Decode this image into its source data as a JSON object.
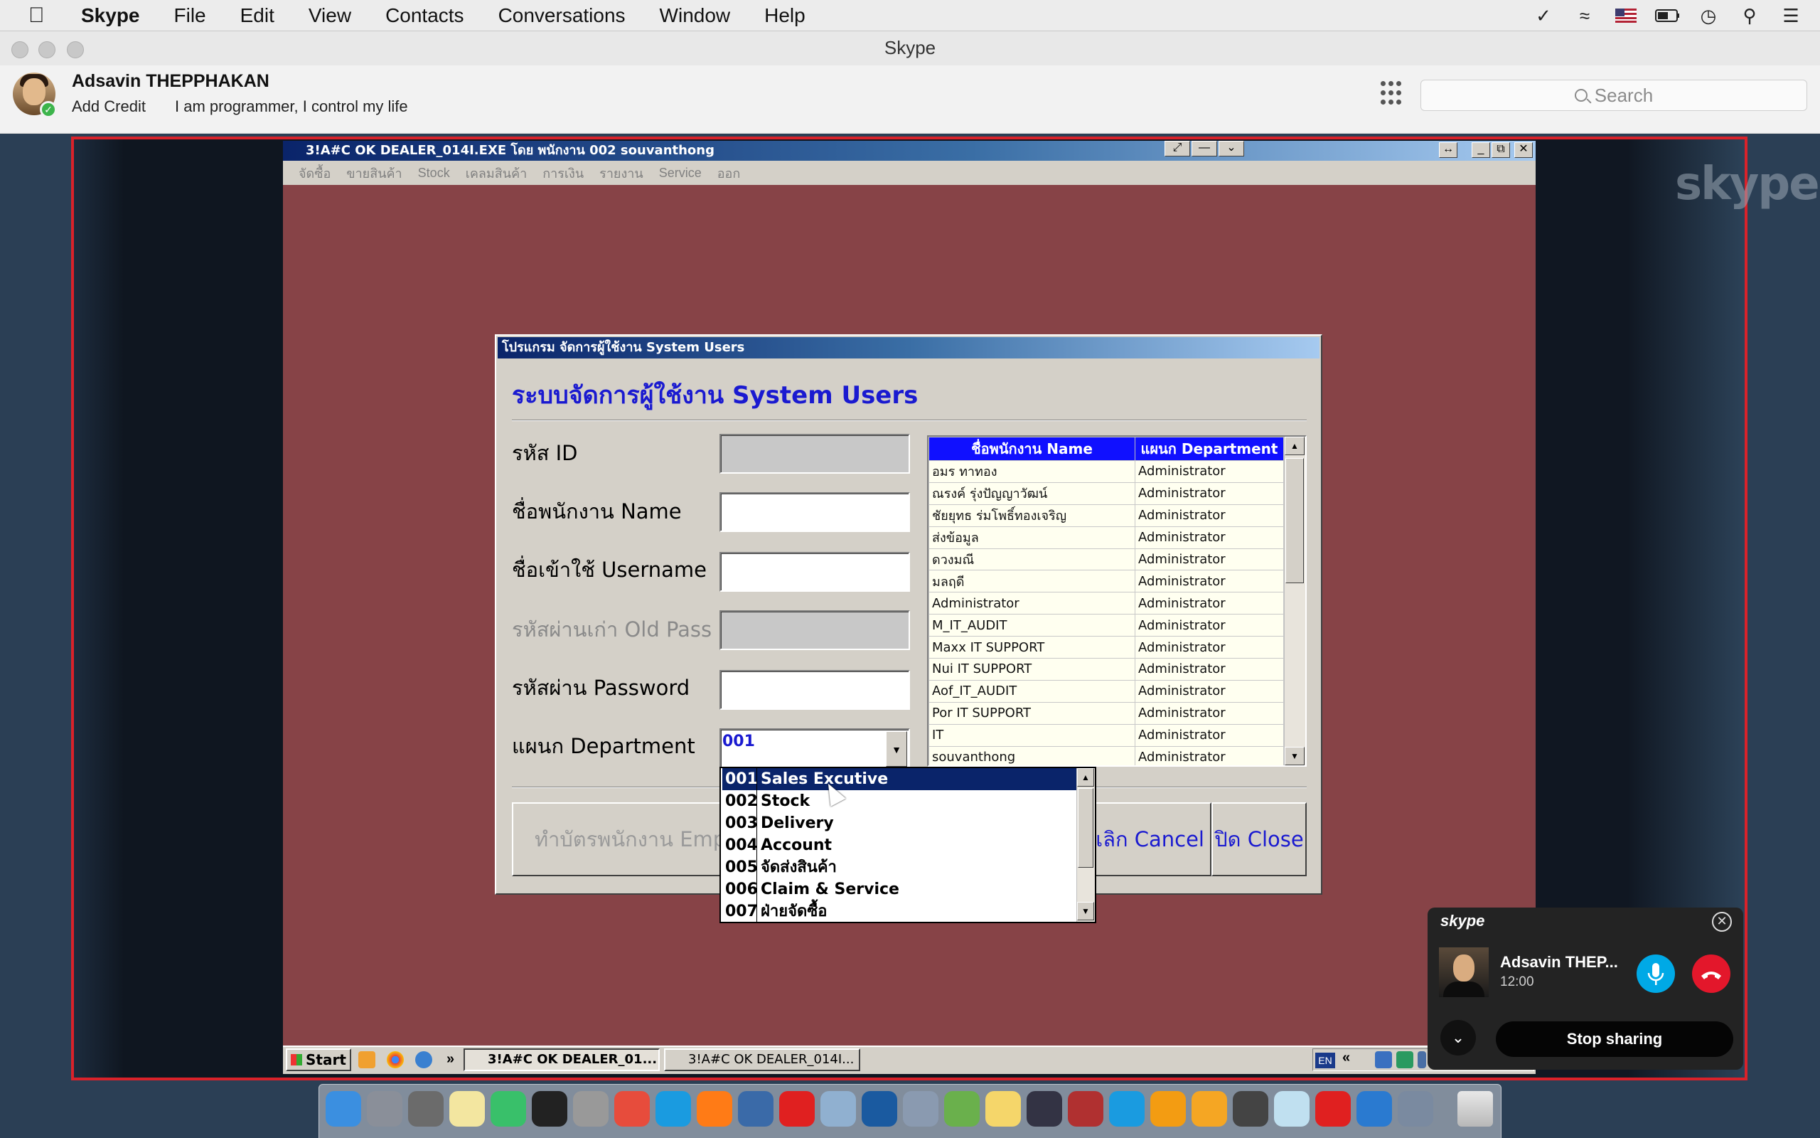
{
  "menubar": {
    "app": "Skype",
    "items": [
      "File",
      "Edit",
      "View",
      "Contacts",
      "Conversations",
      "Window",
      "Help"
    ]
  },
  "window": {
    "title": "Skype"
  },
  "profile": {
    "name": "Adsavin THEPPHAKAN",
    "add_credit": "Add Credit",
    "mood": "I am programmer, I control my life"
  },
  "search": {
    "placeholder": "Search"
  },
  "remote": {
    "title": "3!A#C OK DEALER_014I.EXE โดย พนักงาน 002 souvanthong",
    "menu": [
      "จัดซื้อ",
      "ขายสินค้า",
      "Stock",
      "เคลมสินค้า",
      "การเงิน",
      "รายงาน",
      "Service",
      "ออก"
    ],
    "dialog": {
      "title": "โปรแกรม จัดการผู้ใช้งาน System Users",
      "heading": "ระบบจัดการผู้ใช้งาน System Users",
      "labels": {
        "id": "รหัส ID",
        "name": "ชื่อพนักงาน Name",
        "username": "ชื่อเข้าใช้ Username",
        "old_pass": "รหัสผ่านเก่า Old Pass",
        "password": "รหัสผ่าน Password",
        "department": "แผนก Department"
      },
      "department_value": "001",
      "grid": {
        "headers": [
          "ชื่อพนักงาน Name",
          "แผนก Department"
        ],
        "rows": [
          [
            "อมร ทาทอง",
            "Administrator"
          ],
          [
            "ณรงค์ รุ่งปัญญาวัฒน์",
            "Administrator"
          ],
          [
            "ชัยยุทธ ร่มโพธิ์ทองเจริญ",
            "Administrator"
          ],
          [
            "ส่งข้อมูล",
            "Administrator"
          ],
          [
            "ดวงมณี",
            "Administrator"
          ],
          [
            "มลฤดี",
            "Administrator"
          ],
          [
            "Administrator",
            "Administrator"
          ],
          [
            "M_IT_AUDIT",
            "Administrator"
          ],
          [
            "Maxx IT SUPPORT",
            "Administrator"
          ],
          [
            "Nui IT SUPPORT",
            "Administrator"
          ],
          [
            "Aof_IT_AUDIT",
            "Administrator"
          ],
          [
            "Por IT SUPPORT",
            "Administrator"
          ],
          [
            "IT",
            "Administrator"
          ],
          [
            "souvanthong",
            "Administrator"
          ]
        ]
      },
      "dropdown": [
        {
          "code": "001",
          "name": "Sales Excutive"
        },
        {
          "code": "002",
          "name": "Stock"
        },
        {
          "code": "003",
          "name": "Delivery"
        },
        {
          "code": "004",
          "name": "Account"
        },
        {
          "code": "005",
          "name": "จัดส่งสินค้า"
        },
        {
          "code": "006",
          "name": "Claim & Service"
        },
        {
          "code": "007",
          "name": "ฝ่ายจัดซื้อ"
        }
      ],
      "buttons": {
        "card": "ทำบัตรพนักงาน Emp",
        "cancel": "ยกเลิก Cancel",
        "close": "ปิด Close"
      }
    },
    "taskbar": {
      "start": "Start",
      "tasks": [
        "3!A#C OK DEALER_01...",
        "3!A#C OK DEALER_014I..."
      ],
      "lang": "EN"
    }
  },
  "call": {
    "logo": "skype",
    "name": "Adsavin THEP...",
    "time": "12:00",
    "stop_sharing": "Stop sharing"
  },
  "watermark": "skype",
  "colors": {
    "share_border": "#d9222a",
    "app_background": "#874347",
    "grid_header": "#1010ff",
    "selection": "#0a246a"
  }
}
